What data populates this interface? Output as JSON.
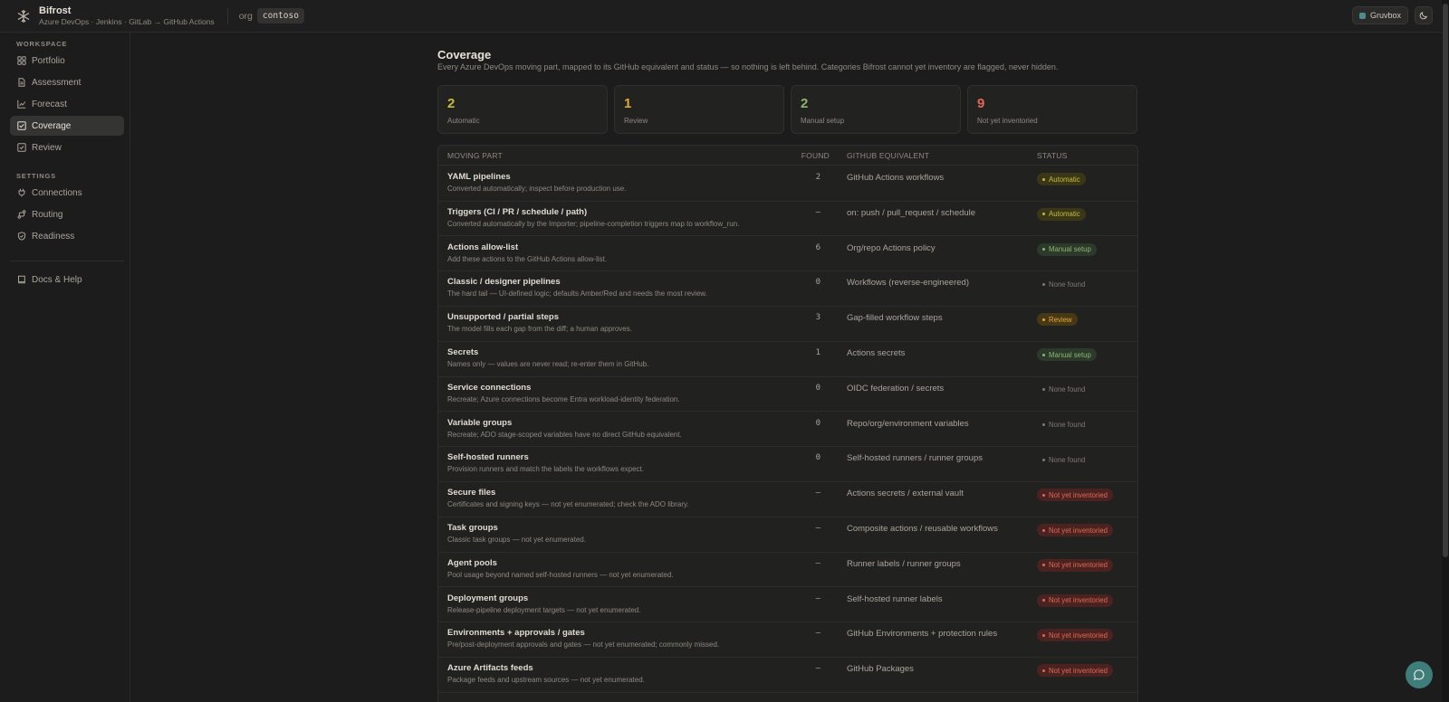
{
  "app": {
    "name": "Bifrost",
    "subtitle": "Azure DevOps · Jenkins · GitLab → GitHub Actions",
    "org_label": "org",
    "org_value": "contoso"
  },
  "header": {
    "theme_label": "Gruvbox"
  },
  "sidebar": {
    "workspace_label": "WORKSPACE",
    "workspace_items": [
      {
        "label": "Portfolio",
        "icon": "grid-icon"
      },
      {
        "label": "Assessment",
        "icon": "file-icon"
      },
      {
        "label": "Forecast",
        "icon": "chart-icon"
      },
      {
        "label": "Coverage",
        "icon": "checklist-icon",
        "active": true
      },
      {
        "label": "Review",
        "icon": "review-icon"
      }
    ],
    "settings_label": "SETTINGS",
    "settings_items": [
      {
        "label": "Connections",
        "icon": "plug-icon"
      },
      {
        "label": "Routing",
        "icon": "route-icon"
      },
      {
        "label": "Readiness",
        "icon": "shield-icon"
      }
    ],
    "help_label": "Docs & Help"
  },
  "page": {
    "title": "Coverage",
    "description": "Every Azure DevOps moving part, mapped to its GitHub equivalent and status — so nothing is left behind. Categories Bifrost cannot yet inventory are flagged, never hidden."
  },
  "stats": [
    {
      "value": "2",
      "label": "Automatic",
      "color": "#c7bb3a"
    },
    {
      "value": "1",
      "label": "Review",
      "color": "#e2a93a"
    },
    {
      "value": "2",
      "label": "Manual setup",
      "color": "#8fb470"
    },
    {
      "value": "9",
      "label": "Not yet inventoried",
      "color": "#e06a57"
    }
  ],
  "table": {
    "headers": {
      "moving_part": "MOVING PART",
      "found": "FOUND",
      "github_equivalent": "GITHUB EQUIVALENT",
      "status": "STATUS"
    },
    "rows": [
      {
        "title": "YAML pipelines",
        "sub": "Converted automatically; inspect before production use.",
        "found": "2",
        "gh": "GitHub Actions workflows",
        "status": "Automatic",
        "kind": "auto"
      },
      {
        "title": "Triggers (CI / PR / schedule / path)",
        "sub": "Converted automatically by the Importer; pipeline-completion triggers map to workflow_run.",
        "found": "–",
        "gh": "on: push / pull_request / schedule",
        "status": "Automatic",
        "kind": "auto"
      },
      {
        "title": "Actions allow-list",
        "sub": "Add these actions to the GitHub Actions allow-list.",
        "found": "6",
        "gh": "Org/repo Actions policy",
        "status": "Manual setup",
        "kind": "manual"
      },
      {
        "title": "Classic / designer pipelines",
        "sub": "The hard tail — UI-defined logic; defaults Amber/Red and needs the most review.",
        "found": "0",
        "gh": "Workflows (reverse-engineered)",
        "status": "None found",
        "kind": "none"
      },
      {
        "title": "Unsupported / partial steps",
        "sub": "The model fills each gap from the diff; a human approves.",
        "found": "3",
        "gh": "Gap-filled workflow steps",
        "status": "Review",
        "kind": "review"
      },
      {
        "title": "Secrets",
        "sub": "Names only — values are never read; re-enter them in GitHub.",
        "found": "1",
        "gh": "Actions secrets",
        "status": "Manual setup",
        "kind": "manual"
      },
      {
        "title": "Service connections",
        "sub": "Recreate; Azure connections become Entra workload-identity federation.",
        "found": "0",
        "gh": "OIDC federation / secrets",
        "status": "None found",
        "kind": "none"
      },
      {
        "title": "Variable groups",
        "sub": "Recreate; ADO stage-scoped variables have no direct GitHub equivalent.",
        "found": "0",
        "gh": "Repo/org/environment variables",
        "status": "None found",
        "kind": "none"
      },
      {
        "title": "Self-hosted runners",
        "sub": "Provision runners and match the labels the workflows expect.",
        "found": "0",
        "gh": "Self-hosted runners / runner groups",
        "status": "None found",
        "kind": "none"
      },
      {
        "title": "Secure files",
        "sub": "Certificates and signing keys — not yet enumerated; check the ADO library.",
        "found": "–",
        "gh": "Actions secrets / external vault",
        "status": "Not yet inventoried",
        "kind": "nyi"
      },
      {
        "title": "Task groups",
        "sub": "Classic task groups — not yet enumerated.",
        "found": "–",
        "gh": "Composite actions / reusable workflows",
        "status": "Not yet inventoried",
        "kind": "nyi"
      },
      {
        "title": "Agent pools",
        "sub": "Pool usage beyond named self-hosted runners — not yet enumerated.",
        "found": "–",
        "gh": "Runner labels / runner groups",
        "status": "Not yet inventoried",
        "kind": "nyi"
      },
      {
        "title": "Deployment groups",
        "sub": "Release-pipeline deployment targets — not yet enumerated.",
        "found": "–",
        "gh": "Self-hosted runner labels",
        "status": "Not yet inventoried",
        "kind": "nyi"
      },
      {
        "title": "Environments + approvals / gates",
        "sub": "Pre/post-deployment approvals and gates — not yet enumerated; commonly missed.",
        "found": "–",
        "gh": "GitHub Environments + protection rules",
        "status": "Not yet inventoried",
        "kind": "nyi"
      },
      {
        "title": "Azure Artifacts feeds",
        "sub": "Package feeds and upstream sources — not yet enumerated.",
        "found": "–",
        "gh": "GitHub Packages",
        "status": "Not yet inventoried",
        "kind": "nyi"
      }
    ]
  }
}
